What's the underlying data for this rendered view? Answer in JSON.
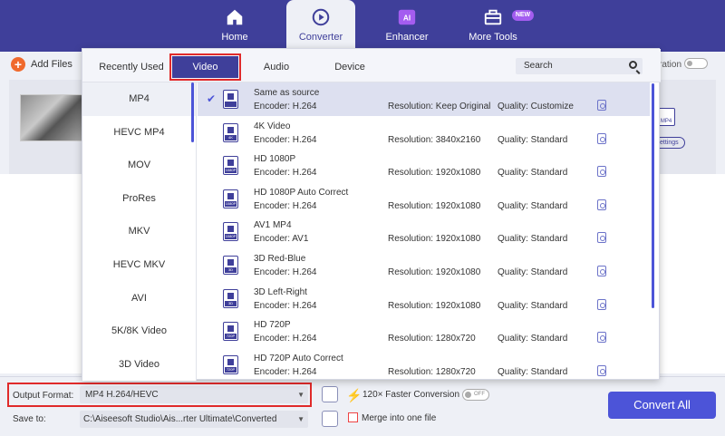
{
  "nav": {
    "items": [
      {
        "label": "Home",
        "icon": "home-icon"
      },
      {
        "label": "Converter",
        "icon": "converter-icon"
      },
      {
        "label": "Enhancer",
        "icon": "ai-enhancer-icon"
      },
      {
        "label": "More Tools",
        "icon": "toolbox-icon"
      }
    ],
    "new_badge": "NEW",
    "ai_badge": "AI"
  },
  "toolbar": {
    "add_files": "Add Files",
    "gen_partial": "ration"
  },
  "file_row": {
    "format_icon_text": "MP4",
    "settings_partial": "Settings"
  },
  "panel": {
    "tabs": [
      {
        "label": "Recently Used"
      },
      {
        "label": "Video"
      },
      {
        "label": "Audio"
      },
      {
        "label": "Device"
      }
    ],
    "active_tab": "Video",
    "search_placeholder": "Search",
    "formats": [
      "MP4",
      "HEVC MP4",
      "MOV",
      "ProRes",
      "MKV",
      "HEVC MKV",
      "AVI",
      "5K/8K Video",
      "3D Video"
    ],
    "selected_format": "MP4",
    "presets": [
      {
        "name": "Same as source",
        "encoder": "Encoder: H.264",
        "resolution": "Resolution: Keep Original",
        "quality": "Quality: Customize",
        "tag": "",
        "selected": true
      },
      {
        "name": "4K Video",
        "encoder": "Encoder: H.264",
        "resolution": "Resolution: 3840x2160",
        "quality": "Quality: Standard",
        "tag": "4K"
      },
      {
        "name": "HD 1080P",
        "encoder": "Encoder: H.264",
        "resolution": "Resolution: 1920x1080",
        "quality": "Quality: Standard",
        "tag": "1080P"
      },
      {
        "name": "HD 1080P Auto Correct",
        "encoder": "Encoder: H.264",
        "resolution": "Resolution: 1920x1080",
        "quality": "Quality: Standard",
        "tag": "1080P"
      },
      {
        "name": "AV1 MP4",
        "encoder": "Encoder: AV1",
        "resolution": "Resolution: 1920x1080",
        "quality": "Quality: Standard",
        "tag": "1080P"
      },
      {
        "name": "3D Red-Blue",
        "encoder": "Encoder: H.264",
        "resolution": "Resolution: 1920x1080",
        "quality": "Quality: Standard",
        "tag": "3D"
      },
      {
        "name": "3D Left-Right",
        "encoder": "Encoder: H.264",
        "resolution": "Resolution: 1920x1080",
        "quality": "Quality: Standard",
        "tag": "3D"
      },
      {
        "name": "HD 720P",
        "encoder": "Encoder: H.264",
        "resolution": "Resolution: 1280x720",
        "quality": "Quality: Standard",
        "tag": "720P"
      },
      {
        "name": "HD 720P Auto Correct",
        "encoder": "Encoder: H.264",
        "resolution": "Resolution: 1280x720",
        "quality": "Quality: Standard",
        "tag": "720P"
      }
    ]
  },
  "bottom": {
    "output_format_label": "Output Format:",
    "output_format_value": "MP4 H.264/HEVC",
    "save_to_label": "Save to:",
    "save_to_value": "C:\\Aiseesoft Studio\\Ais...rter Ultimate\\Converted",
    "faster_conversion": "120× Faster Conversion",
    "toggle_state": "OFF",
    "merge_label": "Merge into one file",
    "convert_all": "Convert All"
  },
  "colors": {
    "nav_bg": "#3f3f9a",
    "accent": "#4c54d8",
    "highlight_box": "#e02a2a",
    "add_button": "#f06a2d"
  }
}
